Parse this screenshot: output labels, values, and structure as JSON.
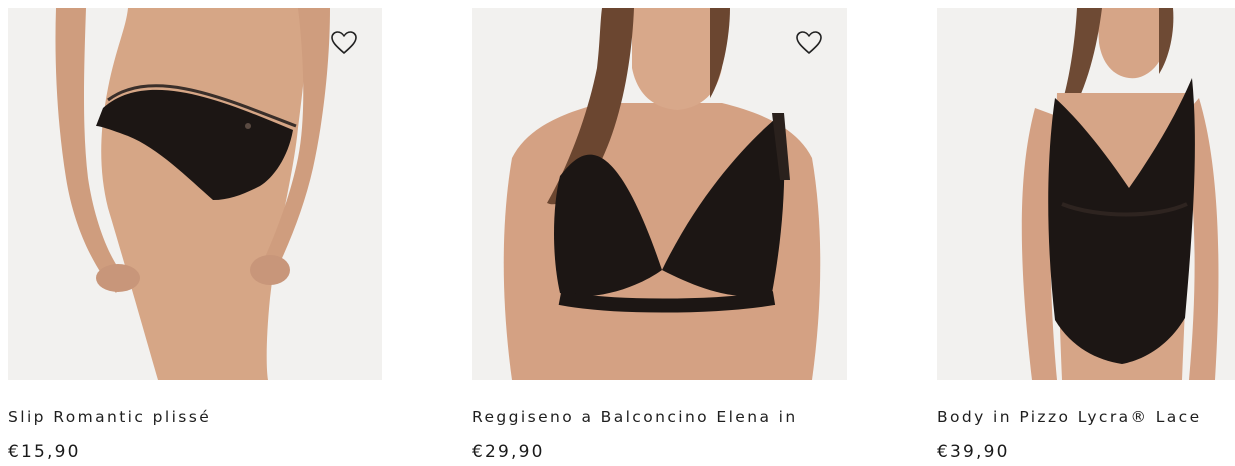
{
  "products": [
    {
      "title": "Slip Romantic plissé",
      "price": "€15,90",
      "image_icon": "lace-slip-photo",
      "wishlist_icon": "heart-outline-icon"
    },
    {
      "title": "Reggiseno a Balconcino Elena in",
      "price": "€29,90",
      "image_icon": "lace-bra-photo",
      "wishlist_icon": "heart-outline-icon"
    },
    {
      "title": "Body in Pizzo Lycra® Lace",
      "price": "€39,90",
      "image_icon": "lace-body-photo"
    }
  ],
  "colors": {
    "image_background": "#f2f1ef",
    "skin": "#d9a888",
    "lace": "#1c1614",
    "text": "#1a1a1a"
  }
}
